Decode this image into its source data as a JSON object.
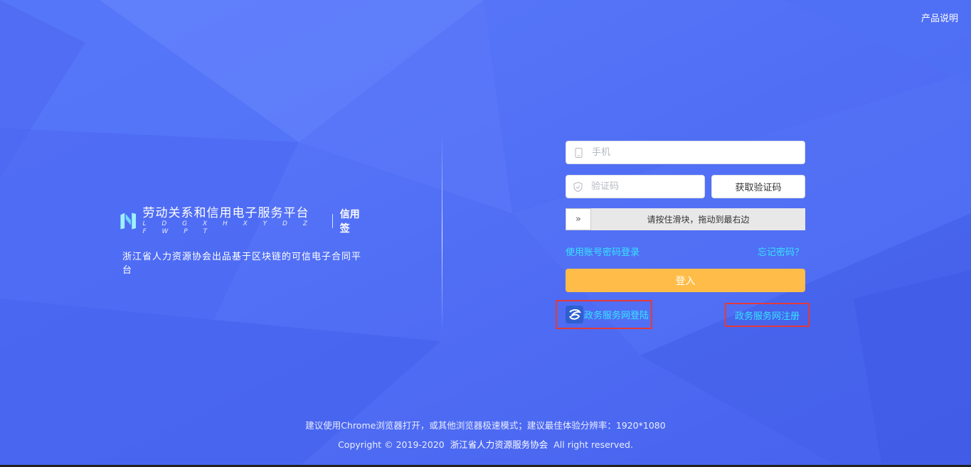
{
  "header": {
    "product_info_link": "产品说明"
  },
  "brand": {
    "title": "劳动关系和信用电子服务平台",
    "pinyin": "L D G X H X Y D Z F W P T",
    "product": "信用签",
    "tagline": "浙江省人力资源协会出品基于区块链的可信电子合同平台"
  },
  "login_form": {
    "phone_placeholder": "手机",
    "code_placeholder": "验证码",
    "get_code_button": "获取验证码",
    "slider_handle_glyph": "»",
    "slider_text": "请按住滑块，拖动到最右边",
    "account_login_link": "使用账号密码登录",
    "forgot_password_link": "忘记密码？",
    "login_button": "登入",
    "gov_login_link": "政务服务网登陆",
    "gov_register_link": "政务服务网注册"
  },
  "footer": {
    "browser_tip": "建议使用Chrome浏览器打开，或其他浏览器极速模式；建议最佳体验分辨率：1920*1080",
    "copyright_prefix": "Copyright © 2019-2020",
    "organization": "浙江省人力资源服务协会",
    "rights": "All right reserved."
  },
  "colors": {
    "background": "#4f6df5",
    "login_button": "#ffbc48",
    "link_cyan": "#36e4ff",
    "highlight_box": "#e33a3a"
  }
}
